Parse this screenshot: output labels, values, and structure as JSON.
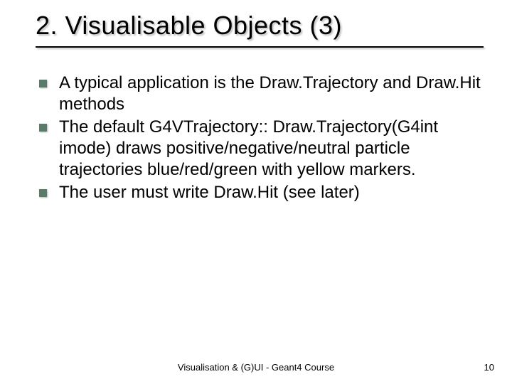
{
  "title": "2. Visualisable Objects (3)",
  "bullets": [
    "A typical application is the Draw.Trajectory and Draw.Hit methods",
    "The default G4VTrajectory:: Draw.Trajectory(G4int imode) draws positive/negative/neutral particle trajectories blue/red/green with yellow markers.",
    "The user must write Draw.Hit (see later)"
  ],
  "footer": {
    "center": "Visualisation & (G)UI - Geant4 Course",
    "page": "10"
  }
}
